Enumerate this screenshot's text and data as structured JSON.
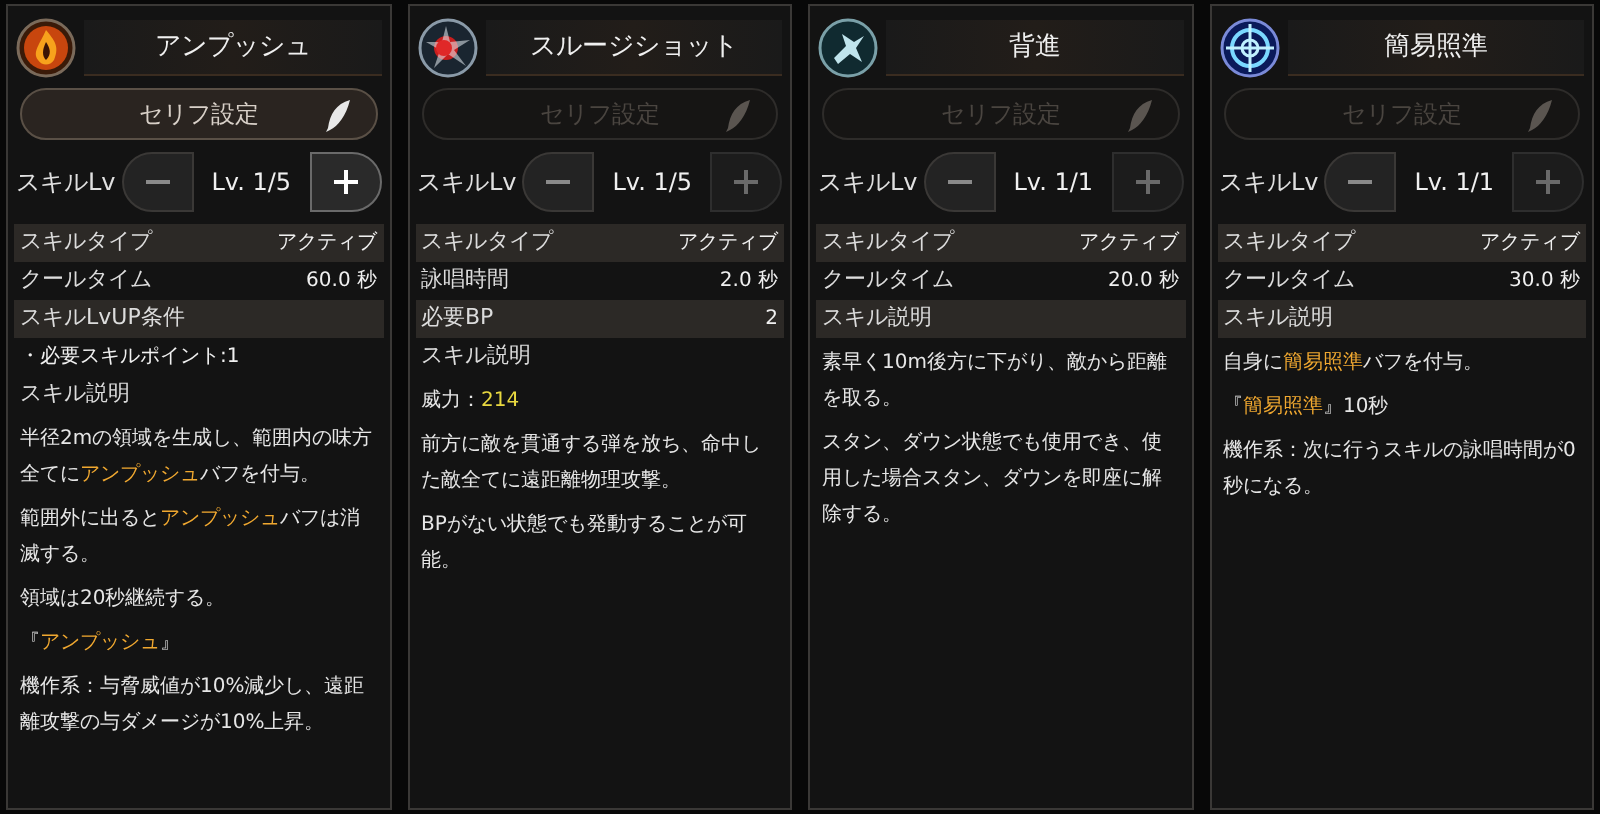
{
  "skills": [
    {
      "title": "アンプッシュ",
      "serif_button": {
        "label": "セリフ設定",
        "disabled": false
      },
      "level": {
        "label": "スキルLv",
        "value": "Lv. 1/5",
        "minus_disabled": true,
        "plus_disabled": false
      },
      "rows": [
        {
          "kind": "stat",
          "label": "スキルタイプ",
          "value": "アクティブ",
          "shaded": true
        },
        {
          "kind": "stat",
          "label": "クールタイム",
          "value": "60.0 秒",
          "shaded": false
        },
        {
          "kind": "header",
          "label": "スキルLvUP条件",
          "shaded": true
        },
        {
          "kind": "bullet",
          "label": "・必要スキルポイント:1"
        },
        {
          "kind": "header",
          "label": "スキル説明",
          "shaded": false
        }
      ],
      "paragraphs": [
        [
          {
            "text": "半径2mの領域を生成し、範囲内の味方全てに",
            "kind": "plain"
          },
          {
            "text": "アンプッシュ",
            "kind": "term"
          },
          {
            "text": "バフを付与。",
            "kind": "plain"
          }
        ],
        [
          {
            "text": "範囲外に出ると",
            "kind": "plain"
          },
          {
            "text": "アンプッシュ",
            "kind": "term"
          },
          {
            "text": "バフは消滅する。",
            "kind": "plain"
          }
        ],
        [
          {
            "text": "領域は20秒継続する。",
            "kind": "plain"
          }
        ],
        [
          {
            "text": "『",
            "kind": "plain"
          },
          {
            "text": "アンプッシュ",
            "kind": "term"
          },
          {
            "text": "』",
            "kind": "plain"
          }
        ],
        [
          {
            "text": "機作系：与脅威値が10%減少し、遠距離攻撃の与ダメージが10%上昇。",
            "kind": "plain"
          }
        ]
      ]
    },
    {
      "title": "スルージショット",
      "serif_button": {
        "label": "セリフ設定",
        "disabled": true
      },
      "level": {
        "label": "スキルLv",
        "value": "Lv. 1/5",
        "minus_disabled": true,
        "plus_disabled": true
      },
      "rows": [
        {
          "kind": "stat",
          "label": "スキルタイプ",
          "value": "アクティブ",
          "shaded": true
        },
        {
          "kind": "stat",
          "label": "詠唱時間",
          "value": "2.0 秒",
          "shaded": false
        },
        {
          "kind": "stat",
          "label": "必要BP",
          "value": "2",
          "shaded": true
        },
        {
          "kind": "header",
          "label": "スキル説明",
          "shaded": false
        }
      ],
      "paragraphs": [
        [
          {
            "text": "威力：",
            "kind": "plain"
          },
          {
            "text": "214",
            "kind": "value"
          }
        ],
        [
          {
            "text": "前方に敵を貫通する弾を放ち、命中した敵全てに遠距離物理攻撃。",
            "kind": "plain"
          }
        ],
        [
          {
            "text": "BPがない状態でも発動することが可能。",
            "kind": "plain"
          }
        ]
      ]
    },
    {
      "title": "背進",
      "serif_button": {
        "label": "セリフ設定",
        "disabled": true
      },
      "level": {
        "label": "スキルLv",
        "value": "Lv. 1/1",
        "minus_disabled": true,
        "plus_disabled": true
      },
      "rows": [
        {
          "kind": "stat",
          "label": "スキルタイプ",
          "value": "アクティブ",
          "shaded": true
        },
        {
          "kind": "stat",
          "label": "クールタイム",
          "value": "20.0 秒",
          "shaded": false
        },
        {
          "kind": "header",
          "label": "スキル説明",
          "shaded": true
        }
      ],
      "paragraphs": [
        [
          {
            "text": "素早く10m後方に下がり、敵から距離を取る。",
            "kind": "plain"
          }
        ],
        [
          {
            "text": "スタン、ダウン状態でも使用でき、使用した場合スタン、ダウンを即座に解除する。",
            "kind": "plain"
          }
        ]
      ]
    },
    {
      "title": "簡易照準",
      "serif_button": {
        "label": "セリフ設定",
        "disabled": true
      },
      "level": {
        "label": "スキルLv",
        "value": "Lv. 1/1",
        "minus_disabled": true,
        "plus_disabled": true
      },
      "rows": [
        {
          "kind": "stat",
          "label": "スキルタイプ",
          "value": "アクティブ",
          "shaded": true
        },
        {
          "kind": "stat",
          "label": "クールタイム",
          "value": "30.0 秒",
          "shaded": false
        },
        {
          "kind": "header",
          "label": "スキル説明",
          "shaded": true
        }
      ],
      "paragraphs": [
        [
          {
            "text": "自身に",
            "kind": "plain"
          },
          {
            "text": "簡易照準",
            "kind": "term"
          },
          {
            "text": "バフを付与。",
            "kind": "plain"
          }
        ],
        [
          {
            "text": "『",
            "kind": "plain"
          },
          {
            "text": "簡易照準",
            "kind": "term"
          },
          {
            "text": "』10秒",
            "kind": "plain"
          }
        ],
        [
          {
            "text": "機作系：次に行うスキルの詠唱時間が0秒になる。",
            "kind": "plain"
          }
        ]
      ]
    }
  ]
}
